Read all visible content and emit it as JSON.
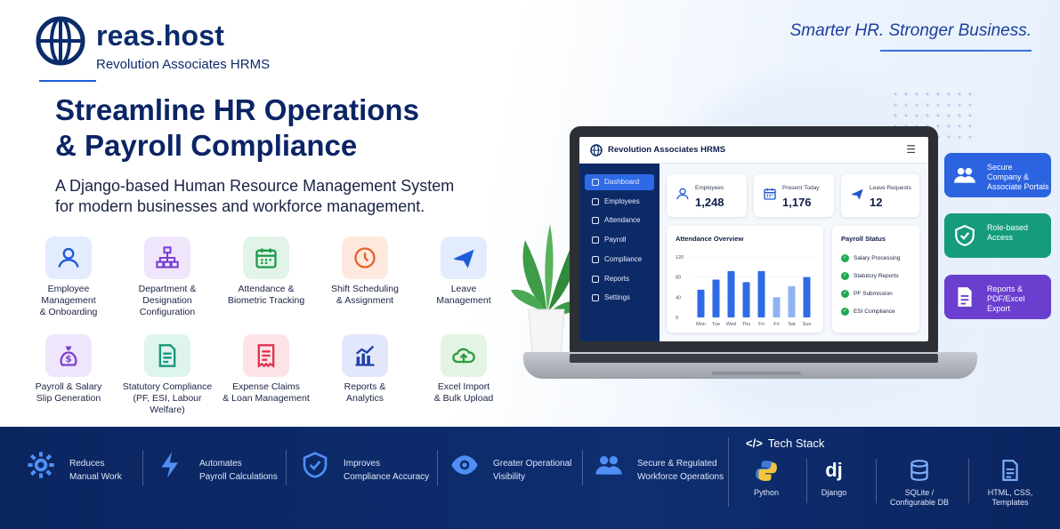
{
  "brand": {
    "name": "reas.host",
    "subtitle": "Revolution Associates HRMS",
    "tagline": "Smarter HR. Stronger Business."
  },
  "hero": {
    "headline_line1": "Streamline HR Operations",
    "headline_line2": "& Payroll Compliance",
    "subhead_line1": "A Django-based Human Resource Management System",
    "subhead_line2": "for modern businesses and workforce management."
  },
  "features": [
    {
      "line1": "Employee",
      "line2": "Management",
      "line3": "& Onboarding",
      "icon": "user-icon",
      "bg": "#e3ecfd",
      "fg": "#1e5bd8"
    },
    {
      "line1": "Department &",
      "line2": "Designation",
      "line3": "Configuration",
      "icon": "org-chart-icon",
      "bg": "#efe6fb",
      "fg": "#7b3fd0"
    },
    {
      "line1": "Attendance &",
      "line2": "Biometric Tracking",
      "line3": "",
      "icon": "calendar-icon",
      "bg": "#e2f4e8",
      "fg": "#1f9a4a"
    },
    {
      "line1": "Shift Scheduling",
      "line2": "& Assignment",
      "line3": "",
      "icon": "clock-icon",
      "bg": "#fde9de",
      "fg": "#e5632a"
    },
    {
      "line1": "Leave",
      "line2": "Management",
      "line3": "",
      "icon": "plane-icon",
      "bg": "#e3ecfd",
      "fg": "#1e5bd8"
    },
    {
      "line1": "Payroll & Salary",
      "line2": "Slip Generation",
      "line3": "",
      "icon": "money-bag-icon",
      "bg": "#efe6fb",
      "fg": "#7b3fd0"
    },
    {
      "line1": "Statutory Compliance",
      "line2": "(PF, ESI, Labour Welfare)",
      "line3": "",
      "icon": "document-icon",
      "bg": "#def4ee",
      "fg": "#17977a"
    },
    {
      "line1": "Expense Claims",
      "line2": "& Loan Management",
      "line3": "",
      "icon": "receipt-icon",
      "bg": "#fde3e6",
      "fg": "#e0334f"
    },
    {
      "line1": "Reports &",
      "line2": "Analytics",
      "line3": "",
      "icon": "bar-chart-icon",
      "bg": "#e3e7fb",
      "fg": "#1e3fa8"
    },
    {
      "line1": "Excel Import",
      "line2": "& Bulk Upload",
      "line3": "",
      "icon": "cloud-upload-icon",
      "bg": "#e4f4e4",
      "fg": "#2f9a3a"
    }
  ],
  "dashboard": {
    "title": "Revolution Associates HRMS",
    "menu_icon": "menu-icon",
    "sidebar": [
      "Dashboard",
      "Employees",
      "Attendance",
      "Payroll",
      "Compliance",
      "Reports",
      "Settings"
    ],
    "stats": [
      {
        "label": "Employees",
        "value": "1,248",
        "icon": "user-icon"
      },
      {
        "label": "Present Today",
        "value": "1,176",
        "icon": "calendar-icon"
      },
      {
        "label": "Leave Requests",
        "value": "12",
        "icon": "plane-icon"
      }
    ],
    "attendance_title": "Attendance Overview",
    "payroll_title": "Payroll Status",
    "payroll_items": [
      "Salary Processing",
      "Statutory Reports",
      "PF Submission",
      "ESI Compliance"
    ]
  },
  "chart_data": {
    "type": "bar",
    "title": "Attendance Overview",
    "categories": [
      "Mon",
      "Tue",
      "Wed",
      "Thu",
      "Fri",
      "Fri",
      "Sat",
      "Sun"
    ],
    "values": [
      55,
      75,
      92,
      70,
      92,
      40,
      62,
      80
    ],
    "y_ticks": [
      "120",
      "80",
      "40",
      "0"
    ],
    "ylim": [
      0,
      120
    ],
    "colors": [
      "#2e6ae6",
      "#2e6ae6",
      "#2e6ae6",
      "#2e6ae6",
      "#2e6ae6",
      "#8fb3f2",
      "#8fb3f2",
      "#2e6ae6"
    ]
  },
  "side_cards": [
    {
      "label": "Secure Company & Associate Portals",
      "line1": "Secure",
      "line2": "Company &",
      "line3": "Associate Portals",
      "icon": "users-icon",
      "color": "#2b63e0"
    },
    {
      "label": "Role-based Access",
      "line1": "Role-based",
      "line2": "Access",
      "line3": "",
      "icon": "shield-check-icon",
      "color": "#149c7c"
    },
    {
      "label": "Reports & PDF/Excel Export",
      "line1": "Reports &",
      "line2": "PDF/Excel Export",
      "line3": "",
      "icon": "file-icon",
      "color": "#6a3fcf"
    }
  ],
  "benefits": [
    {
      "line1": "Reduces",
      "line2": "Manual Work",
      "icon": "gear-icon"
    },
    {
      "line1": "Automates",
      "line2": "Payroll Calculations",
      "icon": "lightning-icon"
    },
    {
      "line1": "Improves",
      "line2": "Compliance Accuracy",
      "icon": "shield-check-icon"
    },
    {
      "line1": "Greater Operational",
      "line2": "Visibility",
      "icon": "eye-icon"
    },
    {
      "line1": "Secure & Regulated",
      "line2": "Workforce Operations",
      "icon": "users-icon"
    }
  ],
  "tech_stack": {
    "title": "Tech Stack",
    "code_icon": "</>",
    "items": [
      {
        "line1": "Python",
        "line2": "",
        "icon": "python-icon"
      },
      {
        "line1": "Django",
        "line2": "",
        "icon": "django-icon",
        "glyph": "dj"
      },
      {
        "line1": "SQLite /",
        "line2": "Configurable DB",
        "icon": "database-icon"
      },
      {
        "line1": "HTML, CSS,",
        "line2": "Templates",
        "icon": "html-file-icon"
      }
    ]
  }
}
